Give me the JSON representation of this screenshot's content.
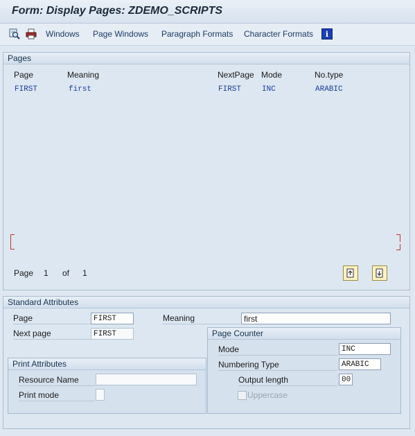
{
  "window": {
    "title": "Form: Display Pages: ZDEMO_SCRIPTS"
  },
  "toolbar": {
    "icons": [
      "search-icon",
      "printer-icon"
    ],
    "menu": [
      "Windows",
      "Page Windows",
      "Paragraph Formats",
      "Character Formats"
    ],
    "info_icon": "info-icon"
  },
  "pages_panel": {
    "title": "Pages",
    "columns": {
      "page": "Page",
      "meaning": "Meaning",
      "next_page": "NextPage",
      "mode": "Mode",
      "no_type": "No.type"
    },
    "rows": [
      {
        "page": "FIRST",
        "meaning": "first",
        "next_page": "FIRST",
        "mode": "INC",
        "no_type": "ARABIC"
      }
    ],
    "pager": {
      "page_label": "Page",
      "current": "1",
      "of_label": "of",
      "total": "1"
    }
  },
  "standard_attributes": {
    "title": "Standard Attributes",
    "page_label": "Page",
    "page_value": "FIRST",
    "meaning_label": "Meaning",
    "meaning_value": "first",
    "next_page_label": "Next page",
    "next_page_value": "FIRST",
    "print_attributes": {
      "title": "Print Attributes",
      "resource_name_label": "Resource Name",
      "resource_name_value": "",
      "print_mode_label": "Print mode",
      "print_mode_value": ""
    },
    "page_counter": {
      "title": "Page Counter",
      "mode_label": "Mode",
      "mode_value": "INC",
      "numbering_type_label": "Numbering Type",
      "numbering_type_value": "ARABIC",
      "output_length_label": "Output length",
      "output_length_value": "00",
      "uppercase_label": "Uppercase",
      "uppercase_checked": false
    }
  },
  "colors": {
    "background": "#dfe8f2",
    "link_blue": "#1b3ca0",
    "marker_red": "#c0392b"
  }
}
